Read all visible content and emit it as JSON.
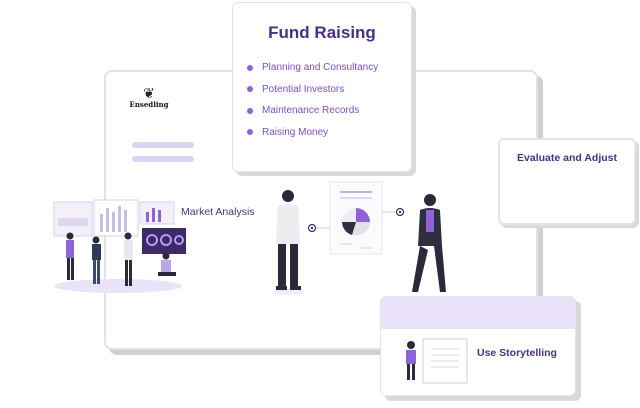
{
  "logo": {
    "name": "Ensedling",
    "tag": ""
  },
  "fund_raising": {
    "title": "Fund Raising",
    "items": [
      "Planning and Consultancy",
      "Potential Investors",
      "Maintenance Records",
      "Raising Money"
    ]
  },
  "market_analysis": {
    "label": "Market Analysis"
  },
  "evaluate": {
    "title": "Evaluate and Adjust"
  },
  "storytelling": {
    "title": "Use Storytelling"
  },
  "colors": {
    "accent": "#8f63d6",
    "heading": "#4b2f86",
    "soft": "#e9e2f8"
  }
}
